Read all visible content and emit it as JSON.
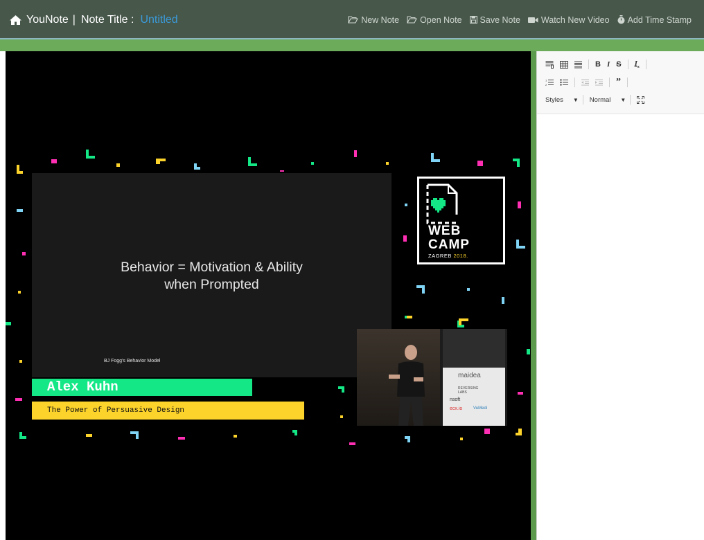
{
  "app": {
    "name": "YouNote",
    "title_label": "Note Title :",
    "title_value": "Untitled"
  },
  "nav": [
    {
      "label": "New Note",
      "icon": "folder-open-icon"
    },
    {
      "label": "Open Note",
      "icon": "folder-open-icon"
    },
    {
      "label": "Save Note",
      "icon": "floppy-disk-icon"
    },
    {
      "label": "Watch New Video",
      "icon": "video-camera-icon"
    },
    {
      "label": "Add Time Stamp",
      "icon": "stopwatch-icon"
    }
  ],
  "video": {
    "slide_title_line1": "Behavior = Motivation & Ability",
    "slide_title_line2": "when Prompted",
    "slide_footer": "BJ Fogg's Behavior Model",
    "speaker_name": "Alex Kuhn",
    "talk_title": "The Power of Persuasive Design",
    "logo_line1": "WEB",
    "logo_line2": "CAMP",
    "logo_city": "ZAGREB",
    "logo_year": "2018.",
    "pip_sponsor1": "maidea",
    "pip_sponsor2": "REVERSING LABS",
    "pip_sponsor3": "nsoft",
    "pip_sponsor4": "ecx.io",
    "pip_sponsor5": "VuMedi"
  },
  "editor": {
    "styles_label": "Styles",
    "format_label": "Normal"
  },
  "colors": {
    "topbar": "#47574a",
    "greenbar": "#6bab5a",
    "accent_blue": "#3a9ad9",
    "name_green": "#13e786",
    "talk_yellow": "#fcd32b"
  }
}
